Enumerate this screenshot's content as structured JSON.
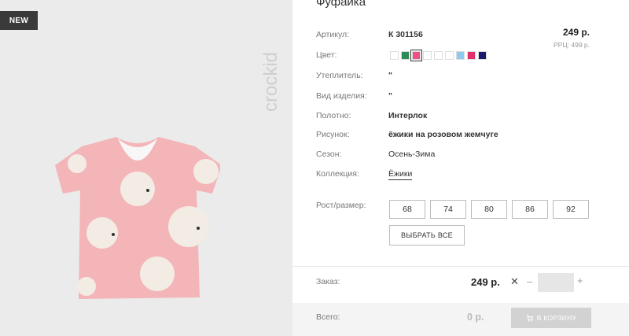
{
  "image": {
    "badge": "NEW",
    "brand": "crockid"
  },
  "product": {
    "title": "Фуфайка",
    "price": "249 р.",
    "rrp": "РРЦ: 499 р."
  },
  "specs": {
    "article": {
      "label": "Артикул:",
      "value": "К 301156"
    },
    "color": {
      "label": "Цвет:"
    },
    "insulation": {
      "label": "Утеплитель:",
      "value": "\""
    },
    "kind": {
      "label": "Вид изделия:",
      "value": "\""
    },
    "fabric": {
      "label": "Полотно:",
      "value": "Интерлок"
    },
    "pattern": {
      "label": "Рисунок:",
      "value": "ёжики на розовом жемчуге"
    },
    "season": {
      "label": "Сезон:",
      "value": "Осень-Зима"
    },
    "collection": {
      "label": "Коллекция:",
      "value": "Ёжики"
    }
  },
  "swatches": [
    {
      "color": "#ffffff",
      "selected": false
    },
    {
      "color": "#2e8b57",
      "selected": false
    },
    {
      "color": "#ee4f86",
      "selected": true
    },
    {
      "color": "#ffffff",
      "selected": false
    },
    {
      "color": "#ffffff",
      "selected": false
    },
    {
      "color": "#ffffff",
      "selected": false
    },
    {
      "color": "#8ec9f0",
      "selected": false
    },
    {
      "color": "#e0316e",
      "selected": false
    },
    {
      "color": "#1a1a6e",
      "selected": false
    }
  ],
  "sizes": {
    "label": "Рост/размер:",
    "options": [
      "68",
      "74",
      "80",
      "86",
      "92"
    ],
    "select_all": "ВЫБРАТЬ ВСЕ"
  },
  "order": {
    "label": "Заказ:",
    "price": "249 р.",
    "times": "✕",
    "minus": "–",
    "quantity": "",
    "plus": "+"
  },
  "total": {
    "label": "Всего:",
    "price": "0 р.",
    "cart_button": "В КОРЗИНУ"
  }
}
